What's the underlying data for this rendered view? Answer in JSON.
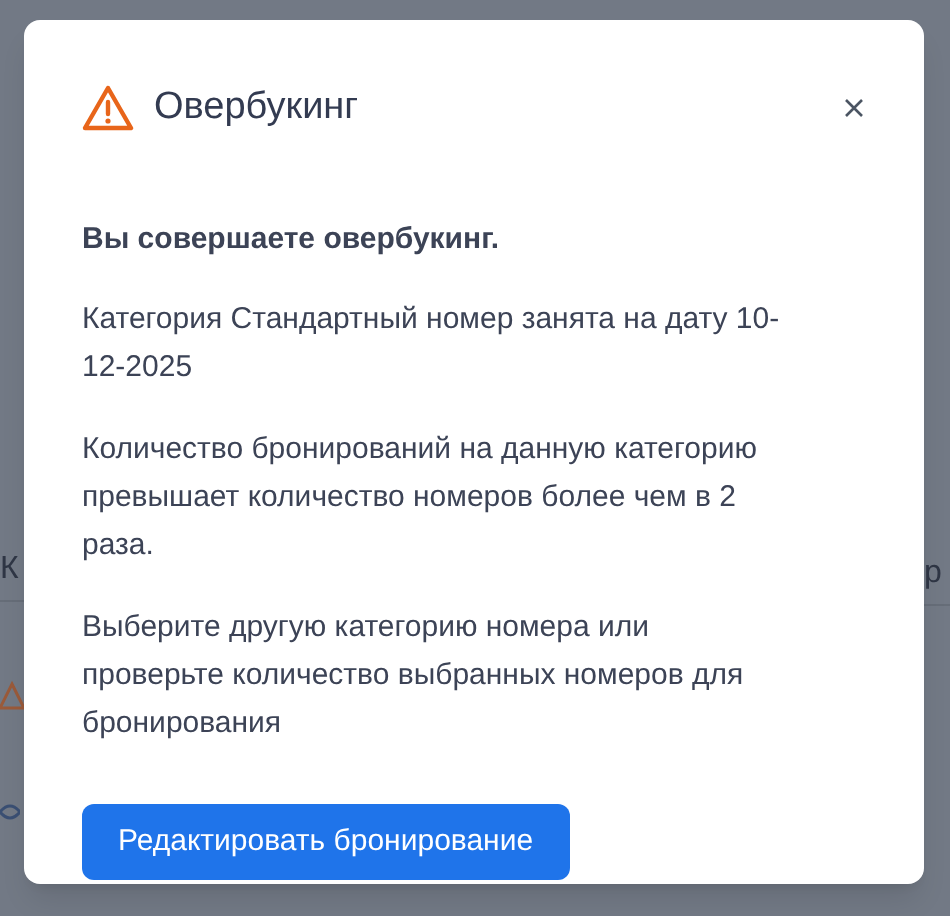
{
  "background": {
    "left_text": "К",
    "right_text": "р"
  },
  "dialog": {
    "title": "Овербукинг",
    "heading": "Вы совершаете овербукинг.",
    "paragraphs": [
      "Категория Стандартный номер занята на дату 10-12-2025",
      "Количество бронирований на данную категорию превышает количество номеров более чем в 2 раза.",
      "Выберите другую категорию номера или проверьте количество выбранных номеров для бронирования"
    ],
    "button": "Редактировать бронирование"
  }
}
